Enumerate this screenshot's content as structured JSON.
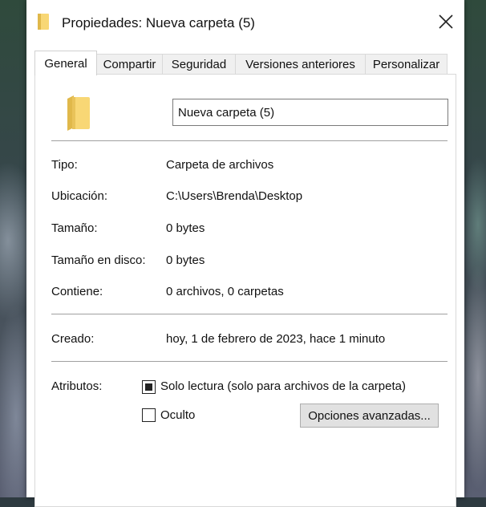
{
  "window": {
    "title": "Propiedades: Nueva carpeta (5)",
    "close_icon": "close-icon"
  },
  "tabs": [
    {
      "label": "General",
      "active": true
    },
    {
      "label": "Compartir",
      "active": false
    },
    {
      "label": "Seguridad",
      "active": false
    },
    {
      "label": "Versiones anteriores",
      "active": false
    },
    {
      "label": "Personalizar",
      "active": false
    }
  ],
  "general": {
    "folder_icon": "folder-icon",
    "name_value": "Nueva carpeta (5)",
    "rows": [
      {
        "label": "Tipo:",
        "value": "Carpeta de archivos"
      },
      {
        "label": "Ubicación:",
        "value": "C:\\Users\\Brenda\\Desktop"
      },
      {
        "label": "Tamaño:",
        "value": "0 bytes"
      },
      {
        "label": "Tamaño en disco:",
        "value": "0 bytes"
      },
      {
        "label": "Contiene:",
        "value": "0 archivos, 0 carpetas"
      }
    ],
    "created": {
      "label": "Creado:",
      "value": "hoy, 1 de febrero de 2023, hace 1 minuto"
    },
    "attributes": {
      "label": "Atributos:",
      "read_only": {
        "label": "Solo lectura (solo para archivos de la carpeta)",
        "state": "indeterminate"
      },
      "hidden": {
        "label": "Oculto",
        "state": "unchecked"
      },
      "advanced_button": "Opciones avanzadas..."
    }
  },
  "colors": {
    "folder_yellow": "#f8d775",
    "folder_shade": "#e0b84a",
    "window_bg": "#ffffff",
    "button_bg": "#e1e1e1"
  }
}
